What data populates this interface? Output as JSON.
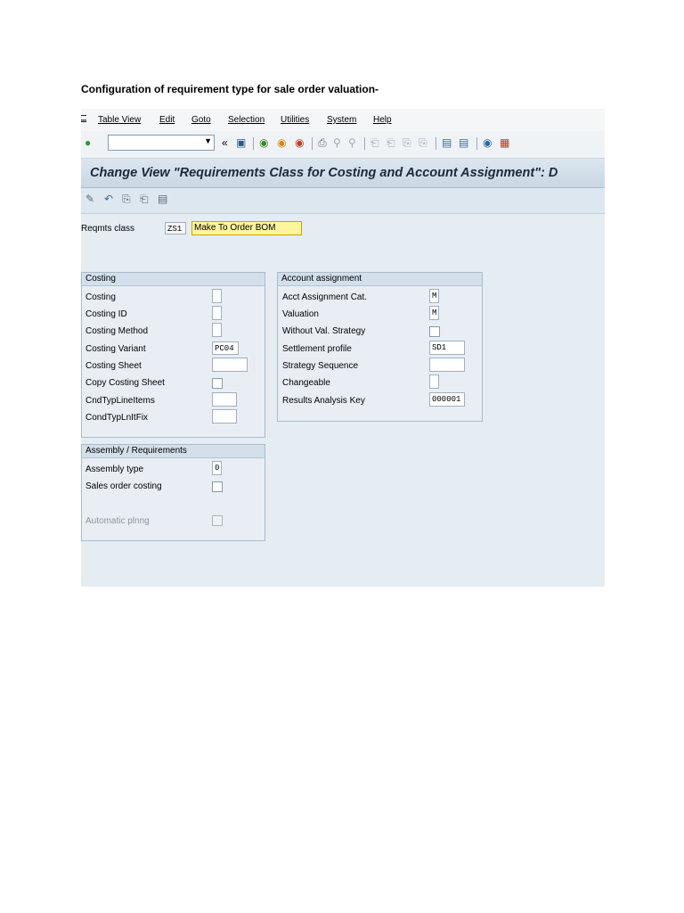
{
  "document": {
    "caption": "Configuration of requirement type for sale order valuation-"
  },
  "menu": [
    "Table View",
    "Edit",
    "Goto",
    "Selection",
    "Utilities",
    "System",
    "Help"
  ],
  "title": "Change View \"Requirements Class for Costing and Account Assignment\": D",
  "reqmts": {
    "label": "Reqmts class",
    "code": "ZS1",
    "description": "Make To Order BOM"
  },
  "costing": {
    "header": "Costing",
    "rows": [
      {
        "label": "Costing",
        "value": ""
      },
      {
        "label": "Costing ID",
        "value": ""
      },
      {
        "label": "Costing Method",
        "value": ""
      },
      {
        "label": "Costing Variant",
        "value": "PC04"
      },
      {
        "label": "Costing Sheet",
        "value": ""
      },
      {
        "label": "Copy Costing Sheet",
        "checked": false
      },
      {
        "label": "CndTypLineItems",
        "value": ""
      },
      {
        "label": "CondTypLnItFix",
        "value": ""
      }
    ]
  },
  "account": {
    "header": "Account assignment",
    "rows": [
      {
        "label": "Acct Assignment Cat.",
        "value": "M"
      },
      {
        "label": "Valuation",
        "value": "M"
      },
      {
        "label": "Without Val. Strategy",
        "checked": false
      },
      {
        "label": "Settlement profile",
        "value": "SD1"
      },
      {
        "label": "Strategy Sequence",
        "value": ""
      },
      {
        "label": "Changeable",
        "value": ""
      },
      {
        "label": "Results Analysis Key",
        "value": "000001"
      }
    ]
  },
  "assembly": {
    "header": "Assembly / Requirements",
    "rows": [
      {
        "label": "Assembly type",
        "value": "0"
      },
      {
        "label": "Sales order costing",
        "checked": false
      },
      {
        "label": "Automatic plnng",
        "checked": false
      }
    ]
  }
}
